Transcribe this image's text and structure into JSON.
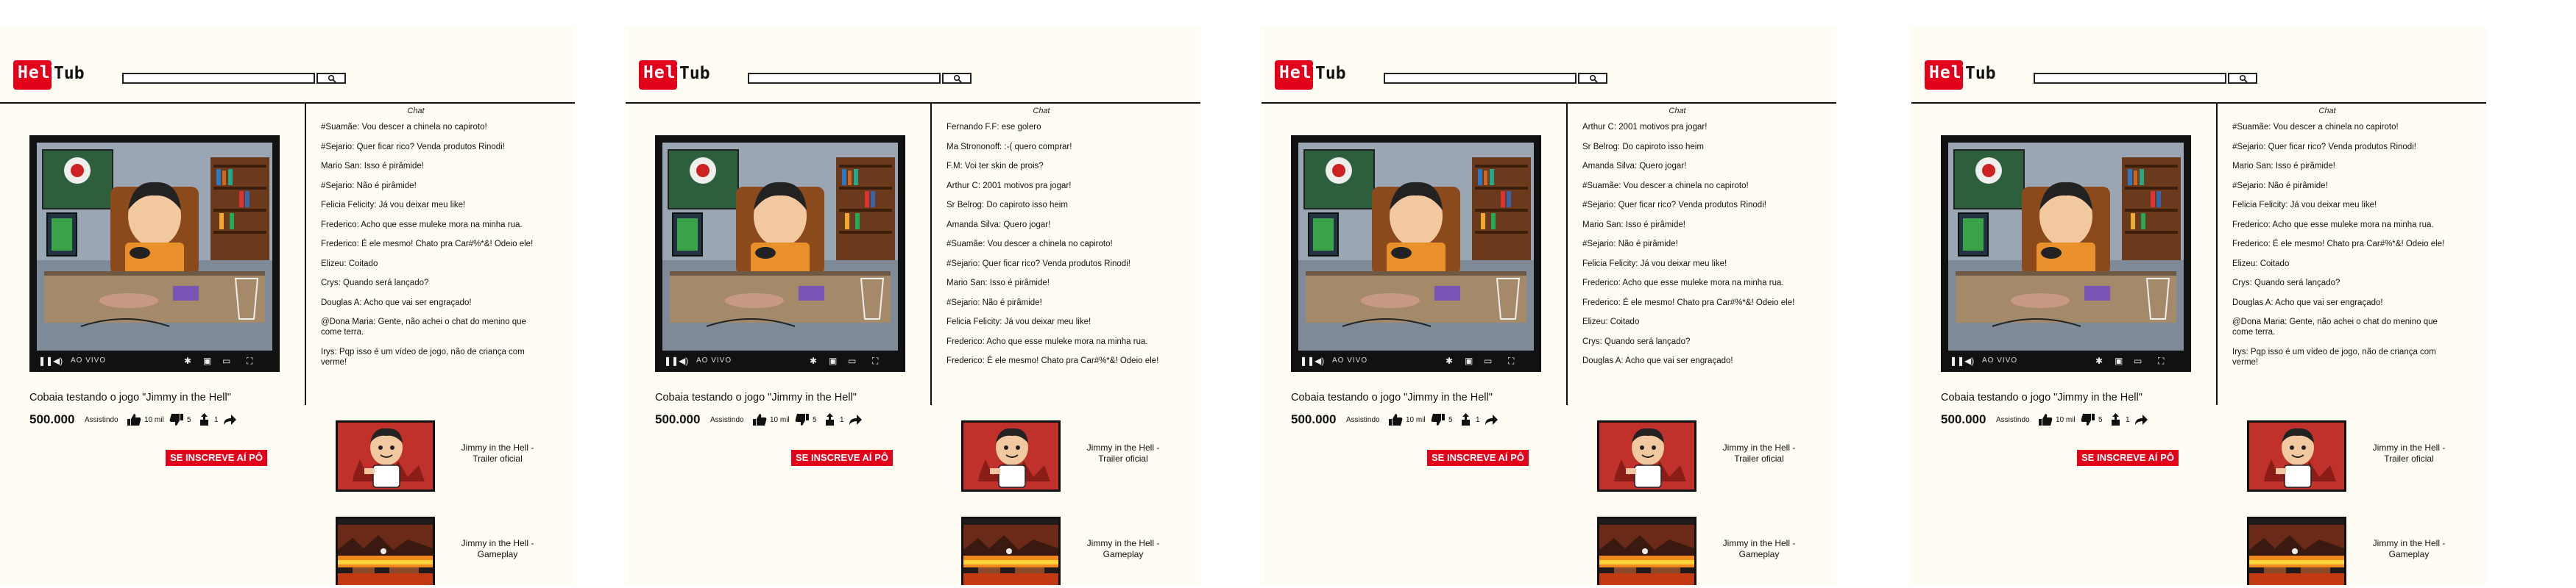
{
  "brand": {
    "logo_text": "Hell",
    "logo_suffix": "Tub"
  },
  "search": {
    "placeholder": "",
    "button_icon": "search-icon"
  },
  "chat": {
    "title": "Chat"
  },
  "video": {
    "live_label": "AO VIVO",
    "title": "Cobaia testando o jogo \"Jimmy in the Hell\"",
    "views": "500.000",
    "watching_label": "Assistindo",
    "likes": "10 mil",
    "dislikes": "5",
    "shares": "1"
  },
  "subscribe_label": "SE INSCREVE AÍ PÔ",
  "related": [
    {
      "title": "Jimmy in the Hell - Trailer oficial"
    },
    {
      "title": "Jimmy in the Hell - Gameplay"
    }
  ],
  "panels": [
    {
      "messages": [
        "#Suamãe: Vou descer a chinela no capiroto!",
        "#Sejario: Quer ficar rico? Venda produtos Rinodi!",
        "Mario San: Isso é pirâmide!",
        "#Sejario: Não é pirâmide!",
        "Felicia Felicity: Já vou deixar meu like!",
        "Frederico: Acho que esse muleke mora na minha rua.",
        "Frederico: É ele mesmo! Chato pra Car#%*&! Odeio ele!",
        "Elizeu: Coitado",
        "Crys: Quando será lançado?",
        "Douglas A: Acho que vai ser engraçado!",
        "@Dona Maria: Gente, não achei o chat do menino que come terra.",
        "Irys: Pqp isso é um vídeo de jogo, não de criança com verme!"
      ]
    },
    {
      "messages": [
        "Fernando F.F: ese golero",
        "Ma Strononoff: :-( quero comprar!",
        "F.M: Voi ter skin de prois?",
        "Arthur C: 2001 motivos pra jogar!",
        "Sr Belrog: Do capiroto isso heim",
        "Amanda Silva: Quero jogar!",
        "#Suamãe: Vou descer a chinela no capiroto!",
        "#Sejario: Quer ficar rico? Venda produtos Rinodi!",
        "Mario San: Isso é pirâmide!",
        "#Sejario: Não é pirâmide!",
        "Felicia Felicity: Já vou deixar meu like!",
        "Frederico: Acho que esse muleke mora na minha rua.",
        "Frederico: É ele mesmo! Chato pra Car#%*&! Odeio ele!"
      ]
    },
    {
      "messages": [
        "Arthur C: 2001 motivos pra jogar!",
        "Sr Belrog: Do capiroto isso heim",
        "Amanda Silva: Quero jogar!",
        "#Suamãe: Vou descer a chinela no capiroto!",
        "#Sejario: Quer ficar rico? Venda produtos Rinodi!",
        "Mario San: Isso é pirâmide!",
        "#Sejario: Não é pirâmide!",
        "Felicia Felicity: Já vou deixar meu like!",
        "Frederico: Acho que esse muleke mora na minha rua.",
        "Frederico: É ele mesmo! Chato pra Car#%*&! Odeio ele!",
        "Elizeu: Coitado",
        "Crys: Quando será lançado?",
        "Douglas A: Acho que vai ser engraçado!"
      ]
    },
    {
      "messages": [
        "#Suamãe: Vou descer a chinela no capiroto!",
        "#Sejario: Quer ficar rico? Venda produtos Rinodi!",
        "Mario San: Isso é pirâmide!",
        "#Sejario: Não é pirâmide!",
        "Felicia Felicity: Já vou deixar meu like!",
        "Frederico: Acho que esse muleke mora na minha rua.",
        "Frederico: É ele mesmo! Chato pra Car#%*&! Odeio ele!",
        "Elizeu: Coitado",
        "Crys: Quando será lançado?",
        "Douglas A: Acho que vai ser engraçado!",
        "@Dona Maria: Gente, não achei o chat do menino que come terra.",
        "Irys: Pqp isso é um vídeo de jogo, não de criança com verme!"
      ]
    }
  ],
  "colors": {
    "brand_red": "#e3001b",
    "panel_bg": "#fffdf3"
  }
}
